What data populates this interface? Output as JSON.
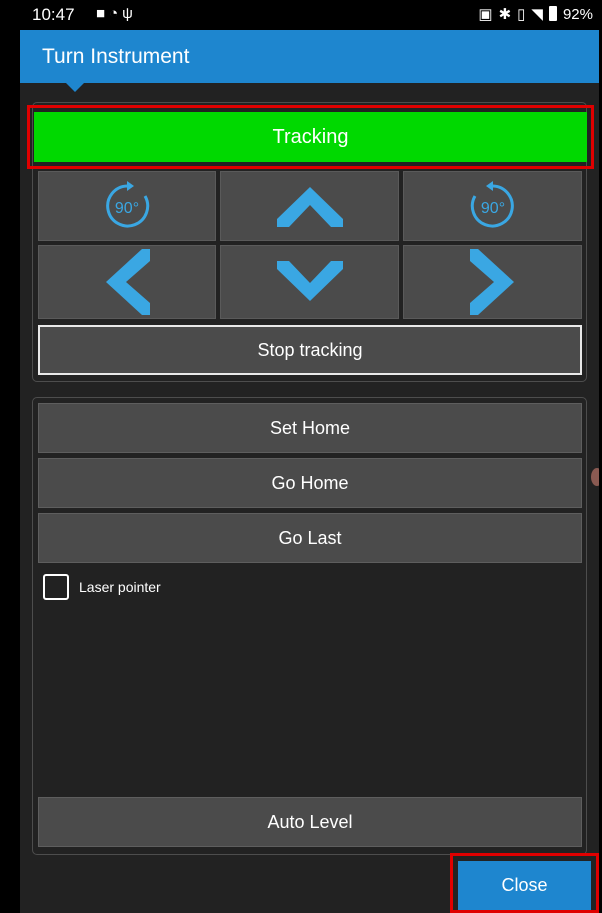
{
  "status_bar": {
    "time": "10:47",
    "left_icons": [
      "video-icon",
      "wifi-icon",
      "usb-icon"
    ],
    "right_icons": [
      "cast-icon",
      "bluetooth-icon",
      "vibrate-icon",
      "signal-icon"
    ],
    "battery": "92%"
  },
  "titlebar": {
    "title": "Turn Instrument"
  },
  "tracking": {
    "label": "Tracking",
    "color": "#00d900"
  },
  "direction_pad": {
    "rotate_cw_label": "90°",
    "rotate_ccw_label": "90°",
    "arrows": [
      "up",
      "left",
      "down",
      "right"
    ]
  },
  "stop_tracking_label": "Stop tracking",
  "actions": {
    "set_home": "Set Home",
    "go_home": "Go Home",
    "go_last": "Go Last",
    "auto_level": "Auto Level"
  },
  "laser_pointer": {
    "label": "Laser pointer",
    "checked": false
  },
  "close_label": "Close",
  "colors": {
    "accent": "#1e86cf",
    "highlight": "#e00000",
    "arrow": "#3aa7e3"
  }
}
